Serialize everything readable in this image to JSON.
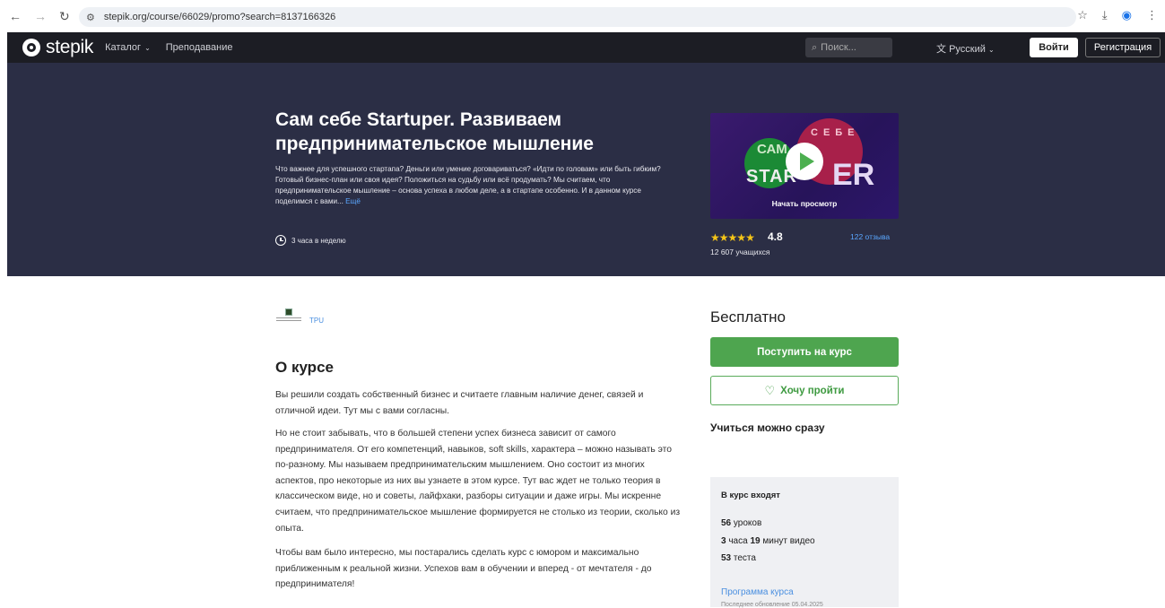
{
  "browser": {
    "url": "stepik.org/course/66029/promo?search=8137166326"
  },
  "header": {
    "logo_text": "stepik",
    "catalog_label": "Каталог",
    "teaching_label": "Преподавание",
    "search_placeholder": "Поиск...",
    "language_label": "Русский",
    "login_label": "Войти",
    "register_label": "Регистрация"
  },
  "hero": {
    "title": "Сам себе Startuper. Развиваем предпринимательское мышление",
    "description": "Что важнее для успешного стартапа? Деньги или умение договариваться? «Идти по головам» или быть гибким? Готовый бизнес-план или своя идея? Положиться на судьбу или всё продумать? Мы считаем, что предпринимательское мышление – основа успеха в любом деле, а в стартапе особенно. И в данном курсе поделимся с вами...",
    "more_link": "Ещё",
    "hours": "3 часа в неделю",
    "video_watch_label": "Начать просмотр",
    "rating": "4.8",
    "rating_stars": 5,
    "reviews": "122 отзыва",
    "learners": "12 607 учащихся"
  },
  "content": {
    "org_name": "TPU",
    "about_title": "О курсе",
    "paragraphs": [
      "Вы решили создать собственный бизнес и считаете главным наличие денег, связей и отличной идеи. Тут мы с вами согласны.",
      "Но не стоит забывать, что в большей степени успех бизнеса зависит от самого предпринимателя. От его компетенций, навыков, soft skills, характера – можно называть это по-разному. Мы называем предпринимательским мышлением. Оно состоит из многих аспектов, про некоторые из них вы узнаете в этом курсе. Тут вас ждет не только теория в классическом виде, но и советы, лайфхаки, разборы ситуации и даже игры. Мы искренне считаем, что предпринимательское мышление формируется не столько из теории, сколько из опыта.",
      "Чтобы вам было интересно, мы постарались сделать курс с юмором и максимально приближенным к реальной жизни. Успехов вам в обучении и вперед - от мечтателя - до предпринимателя!"
    ]
  },
  "sidebar": {
    "price": "Бесплатно",
    "enroll_label": "Поступить на курс",
    "wishlist_label": "Хочу пройти",
    "start_label": "Учиться можно сразу",
    "includes_title": "В курс входят",
    "lessons_count": "56",
    "lessons_label": "уроков",
    "video_hours": "3",
    "video_hours_label": "часа",
    "video_minutes": "19",
    "video_minutes_label": "минут видео",
    "tests_count": "53",
    "tests_label": "теста",
    "program_link": "Программа курса",
    "last_update": "Последнее обновление 05.04.2025"
  }
}
